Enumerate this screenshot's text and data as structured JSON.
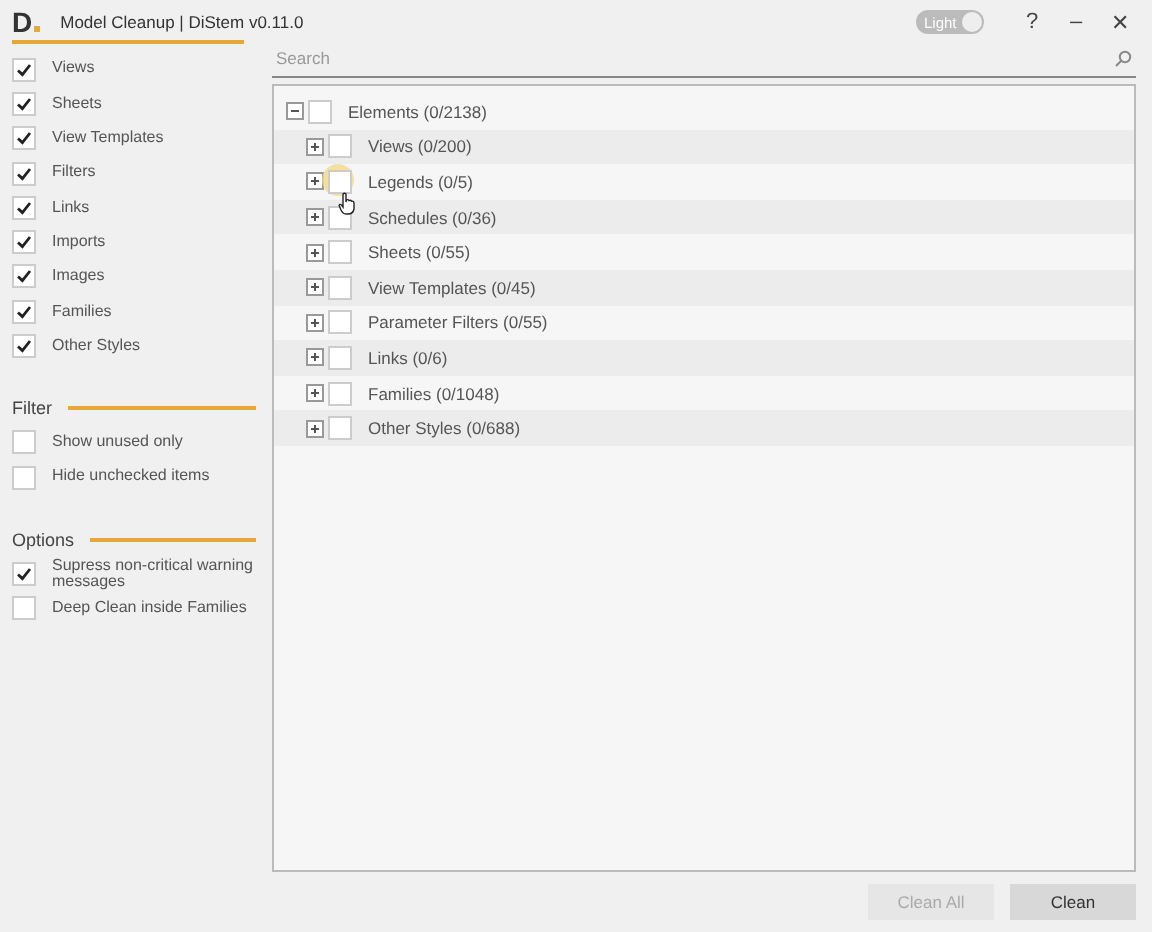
{
  "window": {
    "logo": "D",
    "title": "Model Cleanup | DiStem v0.11.0",
    "theme_toggle": {
      "label": "Light",
      "on": true
    },
    "controls": [
      "?",
      "–",
      "✕"
    ]
  },
  "categories": [
    {
      "label": "Views",
      "checked": true
    },
    {
      "label": "Sheets",
      "checked": true
    },
    {
      "label": "View Templates",
      "checked": true
    },
    {
      "label": "Filters",
      "checked": true
    },
    {
      "label": "Links",
      "checked": true
    },
    {
      "label": "Imports",
      "checked": true
    },
    {
      "label": "Images",
      "checked": true
    },
    {
      "label": "Families",
      "checked": true
    },
    {
      "label": "Other Styles",
      "checked": true
    }
  ],
  "sections": [
    {
      "title": "Filter",
      "items": [
        {
          "label": "Show unused only",
          "checked": false
        },
        {
          "label": "Hide unchecked items",
          "checked": false
        }
      ]
    },
    {
      "title": "Options",
      "items": [
        {
          "label": "Supress non-critical warning messages",
          "checked": true
        },
        {
          "label": "Deep Clean inside Families",
          "checked": false
        }
      ]
    }
  ],
  "search": {
    "placeholder": "Search"
  },
  "tree": [
    {
      "label": "Elements (0/2138)",
      "checked": false,
      "expanded": true,
      "children": [
        {
          "label": "Views (0/200)",
          "checked": false,
          "expanded": false
        },
        {
          "label": "Legends (0/5)",
          "checked": false,
          "expanded": false,
          "hovered": true
        },
        {
          "label": "Schedules (0/36)",
          "checked": false,
          "expanded": false
        },
        {
          "label": "Sheets (0/55)",
          "checked": false,
          "expanded": false
        },
        {
          "label": "View Templates (0/45)",
          "checked": false,
          "expanded": false
        },
        {
          "label": "Parameter Filters (0/55)",
          "checked": false,
          "expanded": false
        },
        {
          "label": "Links (0/6)",
          "checked": false,
          "expanded": false
        },
        {
          "label": "Families (0/1048)",
          "checked": false,
          "expanded": false
        },
        {
          "label": "Other Styles (0/688)",
          "checked": false,
          "expanded": false
        }
      ]
    }
  ],
  "buttons": [
    {
      "label": "Clean All",
      "disabled": true
    },
    {
      "label": "Clean",
      "disabled": false
    }
  ]
}
